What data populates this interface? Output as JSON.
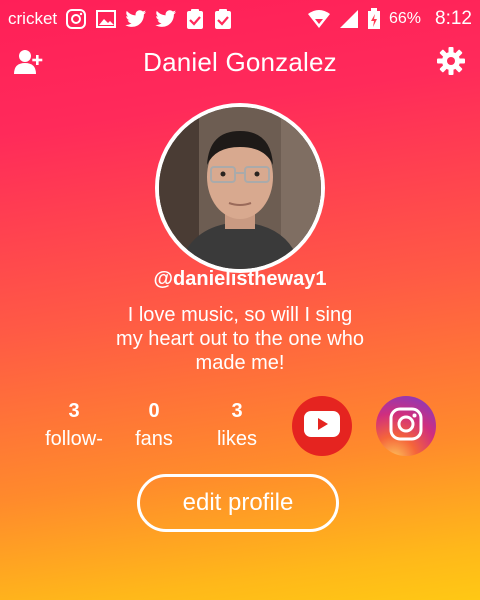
{
  "status_bar": {
    "carrier": "cricket",
    "battery": "66%",
    "time": "8:12",
    "icons": [
      "instagram-icon",
      "image-icon",
      "twitter-icon",
      "twitter-icon",
      "clipboard-check-icon",
      "clipboard-check-icon",
      "wifi-icon",
      "signal-icon",
      "battery-icon"
    ]
  },
  "header": {
    "title": "Daniel Gonzalez"
  },
  "profile": {
    "username": "@danielistheway1",
    "bio": [
      "I love music, so will I sing",
      "my heart out to the one who",
      "made me!"
    ]
  },
  "stats": [
    {
      "value": "3",
      "label": "follow-"
    },
    {
      "value": "0",
      "label": "fans"
    },
    {
      "value": "3",
      "label": "likes"
    }
  ],
  "social": [
    "youtube-icon",
    "instagram-icon"
  ],
  "actions": {
    "edit_profile": "edit profile"
  },
  "colors": {
    "gradient_top": "#ff1f58",
    "gradient_bottom": "#ffc814",
    "youtube": "#e52420"
  }
}
